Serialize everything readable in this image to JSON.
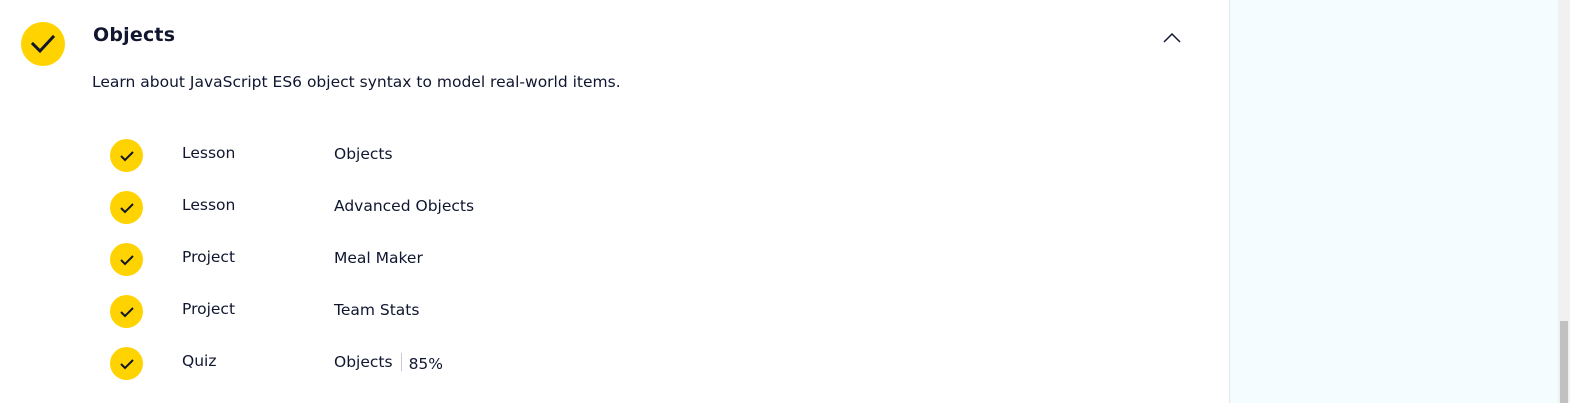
{
  "module": {
    "title": "Objects",
    "description": "Learn about JavaScript ES6 object syntax to model real-world items.",
    "completed": true
  },
  "items": [
    {
      "type": "Lesson",
      "name": "Objects",
      "completed": true
    },
    {
      "type": "Lesson",
      "name": "Advanced Objects",
      "completed": true
    },
    {
      "type": "Project",
      "name": "Meal Maker",
      "completed": true
    },
    {
      "type": "Project",
      "name": "Team Stats",
      "completed": true
    },
    {
      "type": "Quiz",
      "name": "Objects",
      "score": "85%",
      "completed": true
    }
  ],
  "colors": {
    "check_fill": "#ffd300",
    "text": "#10162f",
    "sidebar_bg": "#f5fcff"
  },
  "icons": {
    "check": "check-icon",
    "collapse": "chevron-up-icon"
  }
}
